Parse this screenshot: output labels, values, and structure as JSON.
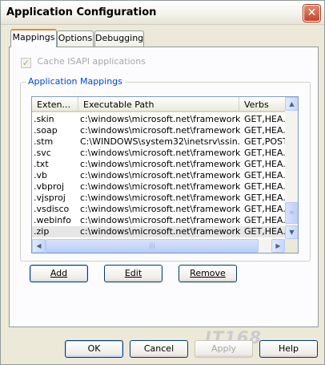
{
  "window": {
    "title": "Application Configuration"
  },
  "tabs": [
    {
      "label": "Mappings",
      "active": true
    },
    {
      "label": "Options",
      "active": false
    },
    {
      "label": "Debugging",
      "active": false
    }
  ],
  "cache": {
    "label": "Cache ISAPI applications",
    "checked": true,
    "enabled": false
  },
  "mappings_group": {
    "label": "Application Mappings"
  },
  "list": {
    "columns": [
      "Exten...",
      "Executable Path",
      "Verbs"
    ],
    "rows": [
      {
        "ext": ".skin",
        "path": "c:\\windows\\microsoft.net\\framework\\...",
        "verbs": "GET,HEA..."
      },
      {
        "ext": ".soap",
        "path": "c:\\windows\\microsoft.net\\framework\\...",
        "verbs": "GET,HEA..."
      },
      {
        "ext": ".stm",
        "path": "C:\\WINDOWS\\system32\\inetsrv\\ssin...",
        "verbs": "GET,POST"
      },
      {
        "ext": ".svc",
        "path": "c:\\windows\\microsoft.net\\framework\\...",
        "verbs": "GET,HEA..."
      },
      {
        "ext": ".txt",
        "path": "c:\\windows\\microsoft.net\\framework\\...",
        "verbs": "GET,HEA..."
      },
      {
        "ext": ".vb",
        "path": "c:\\windows\\microsoft.net\\framework\\...",
        "verbs": "GET,HEA..."
      },
      {
        "ext": ".vbproj",
        "path": "c:\\windows\\microsoft.net\\framework\\...",
        "verbs": "GET,HEA..."
      },
      {
        "ext": ".vjsproj",
        "path": "c:\\windows\\microsoft.net\\framework\\...",
        "verbs": "GET,HEA..."
      },
      {
        "ext": ".vsdisco",
        "path": "c:\\windows\\microsoft.net\\framework\\...",
        "verbs": "GET,HEA..."
      },
      {
        "ext": ".webinfo",
        "path": "c:\\windows\\microsoft.net\\framework\\...",
        "verbs": "GET,HEA..."
      },
      {
        "ext": ".zip",
        "path": "c:\\windows\\microsoft.net\\framework\\...",
        "verbs": "GET,HEA...",
        "selected": true
      }
    ]
  },
  "buttons": {
    "add": "Add",
    "edit": "Edit",
    "remove": "Remove",
    "ok": "OK",
    "cancel": "Cancel",
    "apply": "Apply",
    "help": "Help"
  },
  "watermark": "IT168",
  "icons": {
    "close": "close-icon",
    "scroll_up": "arrow-up-icon",
    "scroll_down": "arrow-down-icon",
    "scroll_left": "arrow-left-icon",
    "scroll_right": "arrow-right-icon"
  },
  "colors": {
    "accent": "#0046d5",
    "active_tab": "#e68b2c",
    "close": "#c5452a"
  }
}
